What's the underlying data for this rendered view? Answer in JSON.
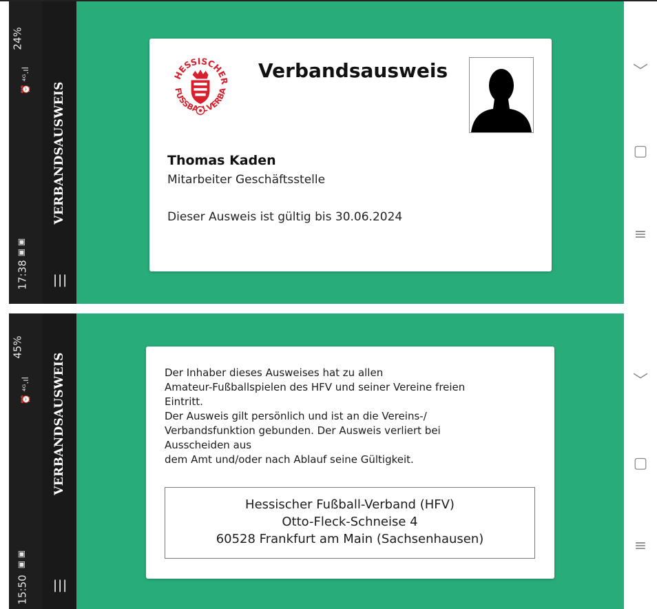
{
  "screens": [
    {
      "status_time": "17:38",
      "status_battery": "24%",
      "app_title": "VERBANDSAUSWEIS",
      "card": {
        "logo_text": "HESSISCHER FUSSBALL VERBAND",
        "title": "Verbandsausweis",
        "name": "Thomas Kaden",
        "role": "Mitarbeiter Geschäftsstelle",
        "validity": "Dieser Ausweis ist gültig bis 30.06.2024"
      }
    },
    {
      "status_time": "15:50",
      "status_battery": "45%",
      "app_title": "VERBANDSAUSWEIS",
      "info_lines": [
        "Der Inhaber dieses Ausweises hat zu allen",
        "Amateur-Fußballspielen des HFV und seiner Vereine freien",
        "Eintritt.",
        "Der Ausweis gilt persönlich und ist an die Vereins-/",
        "Verbandsfunktion gebunden. Der Ausweis verliert bei",
        "Ausscheiden aus",
        "dem Amt und/oder nach Ablauf seine Gültigkeit."
      ],
      "address_lines": [
        "Hessischer Fußball-Verband (HFV)",
        "Otto-Fleck-Schneise 4",
        "60528 Frankfurt am Main (Sachsenhausen)"
      ]
    }
  ],
  "icons": {
    "collapse": "chevron-down-icon",
    "home": "home-icon",
    "menu": "menu-icon",
    "recents": "recents-icon"
  },
  "colors": {
    "background_green": "#28ad7a",
    "app_bar": "#191919",
    "logo_red": "#d6202e"
  }
}
